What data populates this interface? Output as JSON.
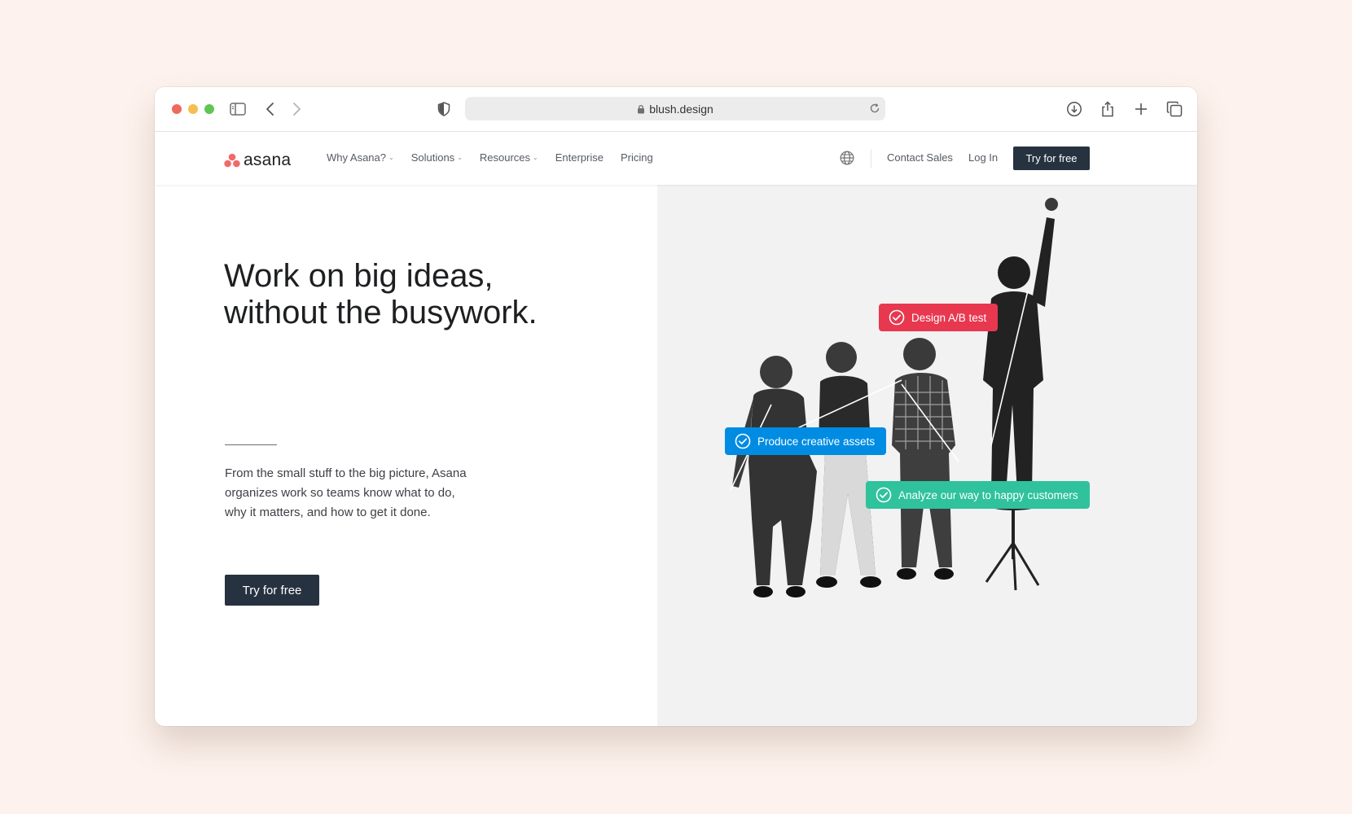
{
  "browser": {
    "url": "blush.design"
  },
  "nav": {
    "logo_text": "asana",
    "links": [
      {
        "label": "Why Asana?",
        "dropdown": true
      },
      {
        "label": "Solutions",
        "dropdown": true
      },
      {
        "label": "Resources",
        "dropdown": true
      },
      {
        "label": "Enterprise",
        "dropdown": false
      },
      {
        "label": "Pricing",
        "dropdown": false
      }
    ],
    "contact_sales": "Contact Sales",
    "login": "Log In",
    "cta": "Try for free"
  },
  "hero": {
    "headline_line1": "Work on big ideas,",
    "headline_line2": "without the busywork.",
    "desc_line1": "From the small stuff to the big picture, Asana",
    "desc_line2": "organizes work so teams know what to do,",
    "desc_line3": "why it matters, and how to get it done.",
    "cta": "Try for free"
  },
  "tasks": [
    {
      "label": "Design A/B test",
      "color": "#e8384f"
    },
    {
      "label": "Produce creative assets",
      "color": "#008ce3"
    },
    {
      "label": "Analyze our way to happy customers",
      "color": "#2fc29d"
    }
  ],
  "colors": {
    "page_bg": "#fdf2ed",
    "button_dark": "#273240",
    "logo_coral": "#f06a6a"
  },
  "icons": [
    "sidebar-icon",
    "back-icon",
    "forward-icon",
    "shield-icon",
    "lock-icon",
    "reload-icon",
    "download-icon",
    "share-icon",
    "new-tab-icon",
    "tabs-icon",
    "globe-icon",
    "check-circle-icon"
  ]
}
